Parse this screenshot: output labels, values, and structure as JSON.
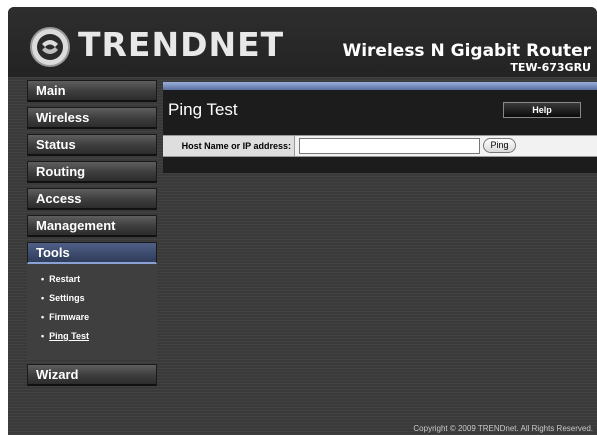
{
  "header": {
    "logo_text": "TRENDNET",
    "product_name": "Wireless N Gigabit Router",
    "model": "TEW-673GRU"
  },
  "sidebar": {
    "items": [
      {
        "label": "Main"
      },
      {
        "label": "Wireless"
      },
      {
        "label": "Status"
      },
      {
        "label": "Routing"
      },
      {
        "label": "Access"
      },
      {
        "label": "Management"
      },
      {
        "label": "Tools"
      },
      {
        "label": "Wizard"
      }
    ],
    "active": "Tools",
    "tools_submenu": [
      {
        "label": "Restart"
      },
      {
        "label": "Settings"
      },
      {
        "label": "Firmware"
      },
      {
        "label": "Ping Test"
      }
    ]
  },
  "main": {
    "title": "Ping Test",
    "help_label": "Help",
    "form": {
      "label": "Host Name or IP address:",
      "value": "",
      "button_label": "Ping"
    }
  },
  "footer": {
    "copyright": "Copyright © 2009 TRENDnet. All Rights Reserved."
  },
  "colors": {
    "background": "#3a3a3a",
    "active_nav": "#2f3c5a",
    "panel_accent": "#9bb0dd"
  }
}
